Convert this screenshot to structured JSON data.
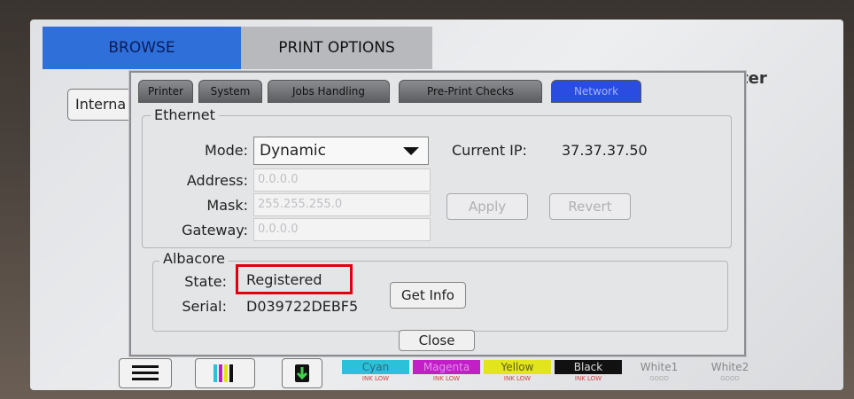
{
  "header": {
    "tab_browse": "BROWSE",
    "tab_print_options": "PRINT OPTIONS",
    "title_fragment": "ter",
    "left_button": "Interna"
  },
  "dialog": {
    "tabs": [
      {
        "label": "Printer",
        "active": false
      },
      {
        "label": "System",
        "active": false
      },
      {
        "label": "Jobs Handling",
        "active": false
      },
      {
        "label": "Pre-Print Checks",
        "active": false
      },
      {
        "label": "Network",
        "active": true
      }
    ],
    "ethernet": {
      "legend": "Ethernet",
      "mode_label": "Mode:",
      "mode_value": "Dynamic",
      "current_ip_label": "Current IP:",
      "current_ip_value": "37.37.37.50",
      "address_label": "Address:",
      "address_value": "0.0.0.0",
      "mask_label": "Mask:",
      "mask_value": "255.255.255.0",
      "gateway_label": "Gateway:",
      "gateway_value": "0.0.0.0",
      "apply_label": "Apply",
      "revert_label": "Revert"
    },
    "albacore": {
      "legend": "Albacore",
      "state_label": "State:",
      "state_value": "Registered",
      "serial_label": "Serial:",
      "serial_value": "D039722DEBF5",
      "get_info_label": "Get Info"
    },
    "close_label": "Close"
  },
  "inks": [
    {
      "name": "Cyan",
      "status": "INK LOW",
      "color": "#2bc1d8"
    },
    {
      "name": "Magenta",
      "status": "INK LOW",
      "color": "#c21fc8"
    },
    {
      "name": "Yellow",
      "status": "INK LOW",
      "color": "#e2e51c"
    },
    {
      "name": "Black",
      "status": "INK LOW",
      "color": "#111111"
    },
    {
      "name": "White1",
      "status": "GOOD",
      "color": "#d8d8da"
    },
    {
      "name": "White2",
      "status": "GOOD",
      "color": "#d8d8da"
    }
  ],
  "colors": {
    "accent": "#2f6fd9",
    "highlight": "#e00010"
  }
}
